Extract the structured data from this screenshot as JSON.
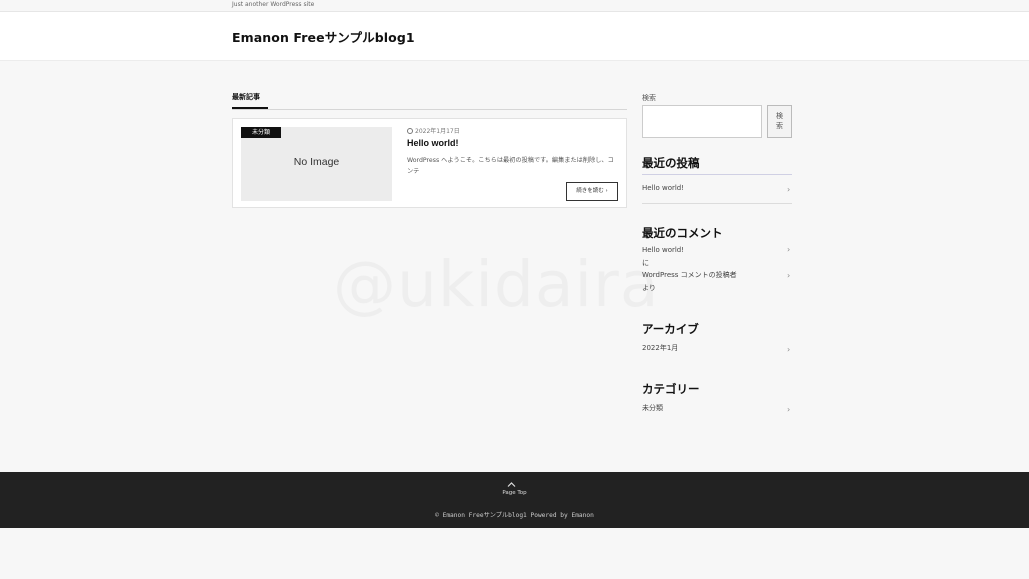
{
  "topbar": {
    "tagline": "Just another WordPress site"
  },
  "header": {
    "site_title": "Emanon Freeサンプルblog1"
  },
  "main": {
    "tab_label": "最新記事",
    "post": {
      "category": "未分類",
      "thumbnail_text": "No Image",
      "date": "2022年1月17日",
      "title": "Hello world!",
      "excerpt": "WordPress へようこそ。こちらは最初の投稿です。編集または削除し、コンテ",
      "read_more": "続きを読む"
    }
  },
  "sidebar": {
    "search": {
      "label": "検索",
      "button": "検索",
      "value": ""
    },
    "recent_posts": {
      "title": "最近の投稿",
      "items": [
        "Hello world!"
      ]
    },
    "recent_comments": {
      "title": "最近のコメント",
      "post": "Hello world!",
      "ni": "に",
      "author": "WordPress コメントの投稿者",
      "yori": "より"
    },
    "archive": {
      "title": "アーカイブ",
      "items": [
        "2022年1月"
      ]
    },
    "categories": {
      "title": "カテゴリー",
      "items": [
        "未分類"
      ]
    }
  },
  "watermark": "@ukidaira",
  "footer": {
    "page_top": "Page Top",
    "copyright": "© Emanon Freeサンプルblog1 Powered by Emanon"
  },
  "icons": {
    "clock": "clock-icon",
    "chevron": "chevron-right-icon",
    "page_top": "chevron-up-icon"
  }
}
